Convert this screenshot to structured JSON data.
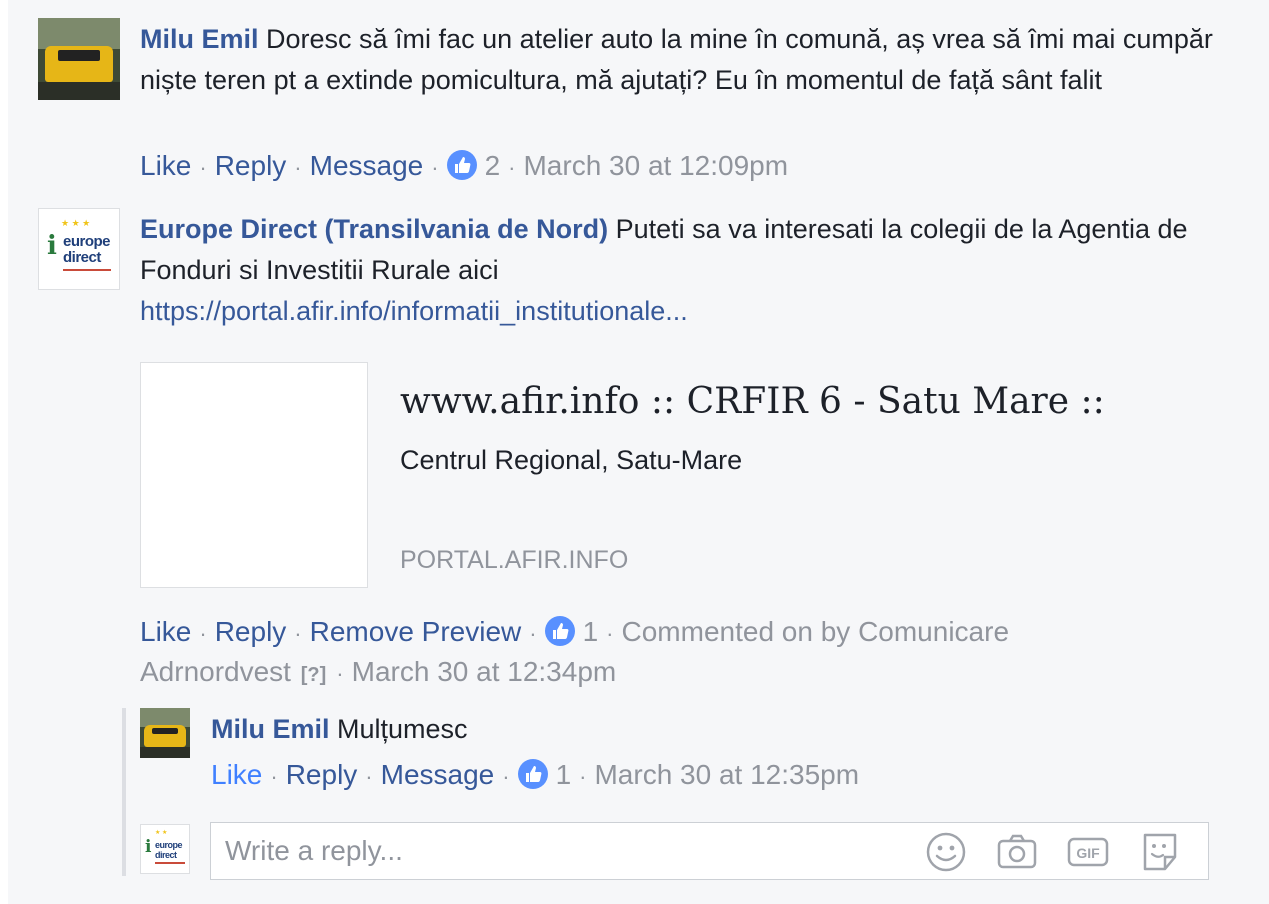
{
  "comments": [
    {
      "author": "Milu Emil",
      "text": " Doresc să îmi fac un atelier auto la mine în comună, aș vrea să îmi mai cumpăr niște teren pt a extinde pomicultura, mă ajutați? Eu în momentul de față sânt falit",
      "actions": {
        "like": "Like",
        "reply": "Reply",
        "third": "Message"
      },
      "like_count": "2",
      "timestamp": "March 30 at 12:09pm"
    },
    {
      "author": "Europe Direct (Transilvania de Nord)",
      "text": " Puteti sa va interesati la colegii de la Agentia de Fonduri si Investitii Rurale aici",
      "link": "https://portal.afir.info/informatii_institutionale...",
      "preview": {
        "title": "www.afir.info :: CRFIR 6 - Satu Mare ::",
        "description": "Centrul Regional, Satu-Mare",
        "domain": "PORTAL.AFIR.INFO"
      },
      "actions": {
        "like": "Like",
        "reply": "Reply",
        "third": "Remove Preview"
      },
      "like_count": "1",
      "commented_by_prefix": "Commented on by Comunicare",
      "commented_by_rest": "Adrnordvest",
      "help": "[?]",
      "timestamp": "March 30 at 12:34pm"
    }
  ],
  "reply": {
    "author": "Milu Emil",
    "text": " Mulțumesc",
    "actions": {
      "like": "Like",
      "reply": "Reply",
      "third": "Message"
    },
    "like_count": "1",
    "timestamp": "March 30 at 12:35pm"
  },
  "composer": {
    "placeholder": "Write a reply...",
    "icons": [
      "emoji-icon",
      "camera-icon",
      "gif-icon",
      "sticker-icon"
    ]
  },
  "avatar_logo_text": [
    "europe",
    "direct"
  ],
  "colors": {
    "link_blue": "#365899",
    "liked_blue": "#4080ff",
    "like_badge": "#5890ff",
    "meta_gray": "#90949c",
    "background": "#f6f7f9"
  }
}
